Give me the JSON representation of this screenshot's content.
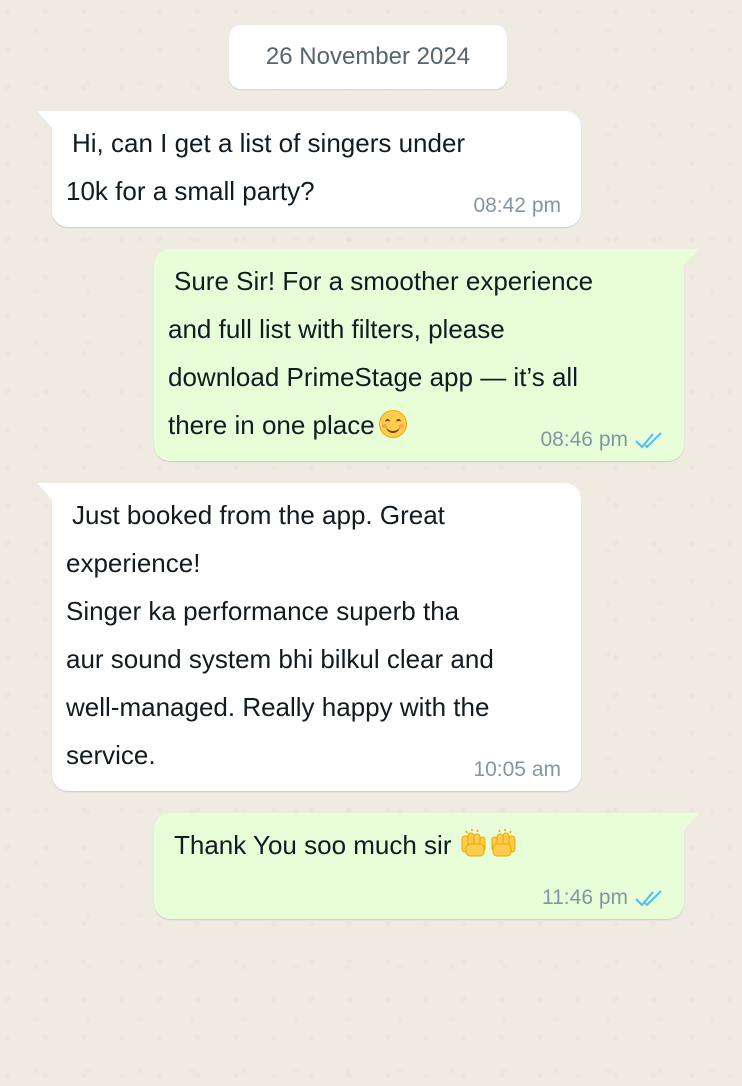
{
  "date_chip": "26 November 2024",
  "messages": [
    {
      "direction": "in",
      "text": "Hi, can I get a list of singers under\n10k for a small party?",
      "time": "08:42 pm"
    },
    {
      "direction": "out",
      "text": "Sure Sir! For a smoother experience\nand full list with filters, please\ndownload PrimeStage app — it’s all\nthere in one place",
      "emoji": "smiling-face-icon",
      "time": "08:46 pm",
      "status": "read"
    },
    {
      "direction": "in",
      "text": "Just booked from the app. Great\nexperience!\nSinger ka performance superb tha\naur sound system bhi bilkul clear and\nwell-managed. Really happy with the\nservice.",
      "time": "10:05 am"
    },
    {
      "direction": "out",
      "text": "Thank You soo much sir",
      "emoji": "raising-hands-icon",
      "time": "11:46 pm",
      "status": "read"
    }
  ],
  "colors": {
    "background": "#efeae2",
    "incoming_bubble": "#ffffff",
    "outgoing_bubble": "#e7fed8",
    "read_ticks": "#53bdeb",
    "meta_text": "#8696a0"
  }
}
